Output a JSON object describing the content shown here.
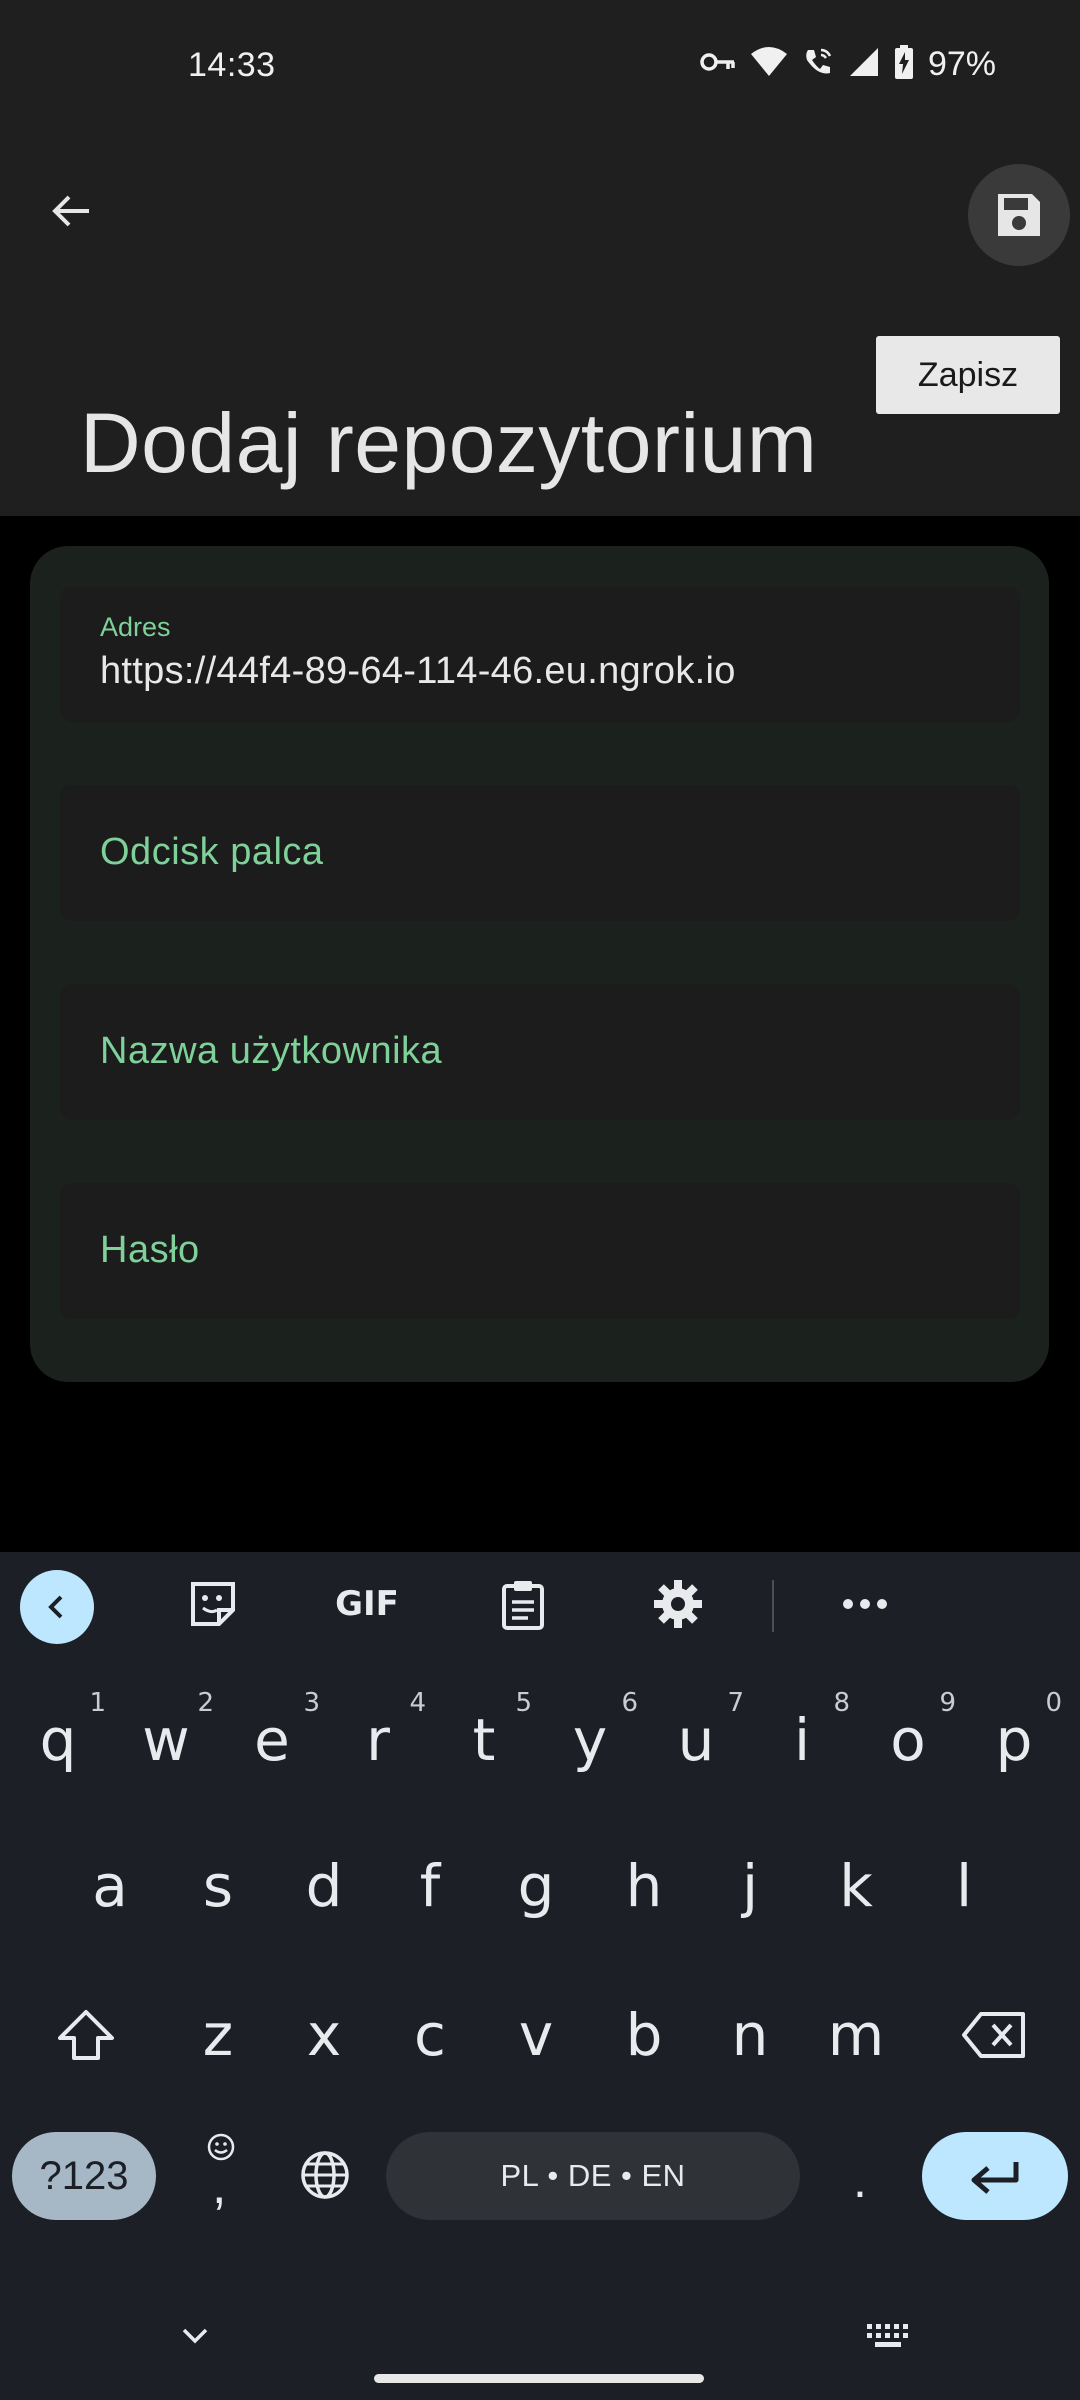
{
  "status_bar": {
    "time": "14:33",
    "battery": "97%",
    "icons": [
      "vpn-key-icon",
      "wifi-icon",
      "wifi-call-icon",
      "signal-icon",
      "battery-charging-icon"
    ]
  },
  "app_bar": {
    "back_icon": "arrow-back-icon",
    "save_icon": "floppy-disk-icon",
    "save_tooltip": "Zapisz",
    "title": "Dodaj repozytorium"
  },
  "form": {
    "address": {
      "label": "Adres",
      "value": "https://44f4-89-64-114-46.eu.ngrok.io"
    },
    "fingerprint": {
      "label": "Odcisk palca"
    },
    "username": {
      "label": "Nazwa użytkownika"
    },
    "password": {
      "label": "Hasło"
    }
  },
  "colors": {
    "accent": "#7fd19a",
    "card_bg": "#1b211d",
    "keyboard_bg": "#1c2026",
    "keyboard_accent": "#bde6ff"
  },
  "keyboard": {
    "toolbar": [
      "chevron-left-icon",
      "sticker-icon",
      "GIF",
      "clipboard-icon",
      "gear-icon",
      "more-icon"
    ],
    "row1": [
      "q",
      "w",
      "e",
      "r",
      "t",
      "y",
      "u",
      "i",
      "o",
      "p"
    ],
    "row1_hints": [
      "1",
      "2",
      "3",
      "4",
      "5",
      "6",
      "7",
      "8",
      "9",
      "0"
    ],
    "row2": [
      "a",
      "s",
      "d",
      "f",
      "g",
      "h",
      "j",
      "k",
      "l"
    ],
    "row3": [
      "z",
      "x",
      "c",
      "v",
      "b",
      "n",
      "m"
    ],
    "symbols_key": "?123",
    "comma_key": ",",
    "space_label": "PL • DE • EN",
    "period_key": "."
  }
}
